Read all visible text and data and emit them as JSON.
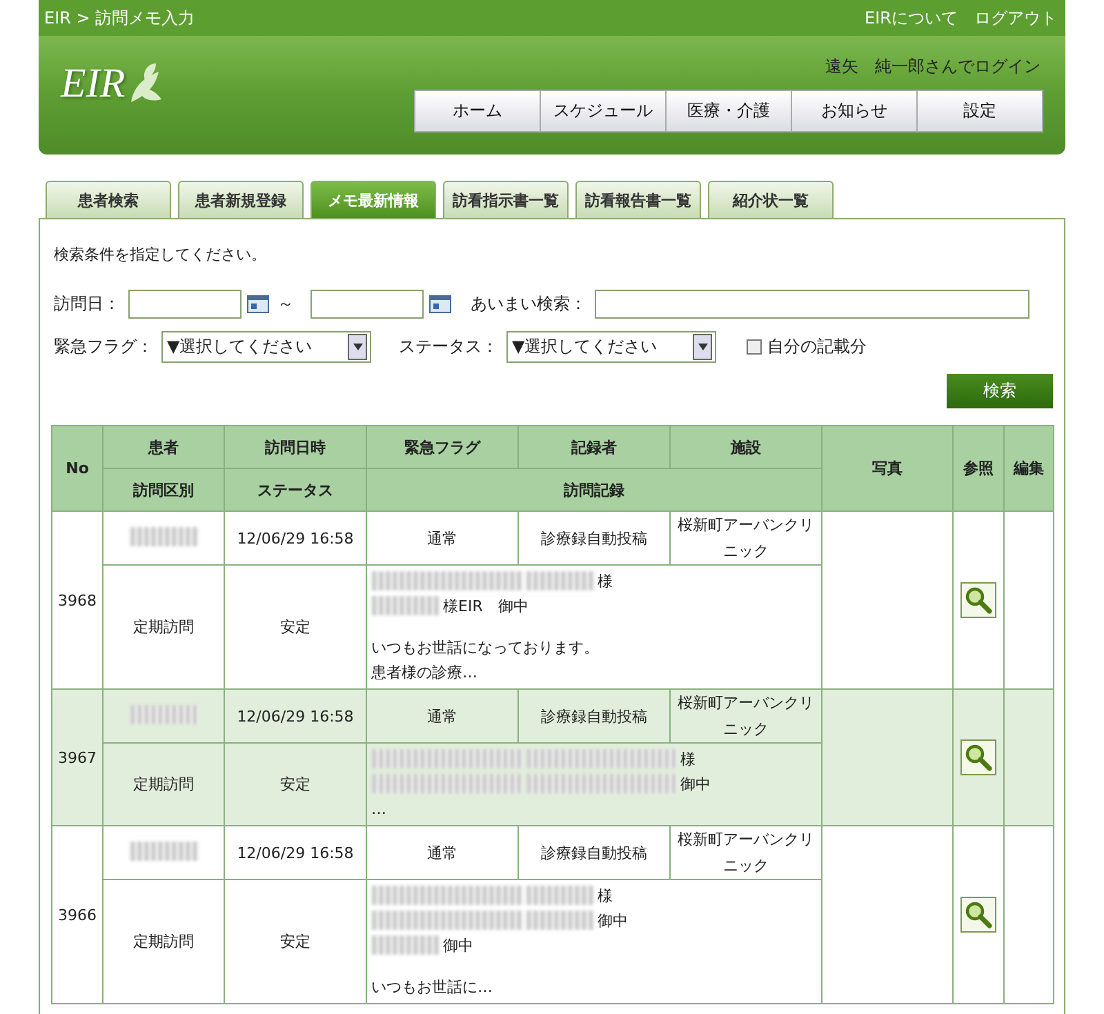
{
  "top_bar": {
    "breadcrumb": "EIR > 訪問メモ入力",
    "links": [
      "EIRについて",
      "ログアウト"
    ]
  },
  "header": {
    "logo": "EIR",
    "login_user": "遠矢　純一郎さんでログイン",
    "nav": [
      "ホーム",
      "スケジュール",
      "医療・介護",
      "お知らせ",
      "設定"
    ]
  },
  "tabs": [
    {
      "label": "患者検索",
      "selected": false
    },
    {
      "label": "患者新規登録",
      "selected": false
    },
    {
      "label": "メモ最新情報",
      "selected": true
    },
    {
      "label": "訪看指示書一覧",
      "selected": false
    },
    {
      "label": "訪看報告書一覧",
      "selected": false
    },
    {
      "label": "紹介状一覧",
      "selected": false
    }
  ],
  "search": {
    "instruction": "検索条件を指定してください。",
    "visit_date_label": "訪問日：",
    "range_sep": "～",
    "fuzzy_label": "あいまい検索：",
    "flag_label": "緊急フラグ：",
    "flag_value": "▼選択してください",
    "status_label": "ステータス：",
    "status_value": "▼選択してください",
    "own_only": {
      "label": "自分の記載分",
      "checked": false
    },
    "button": "検索"
  },
  "table": {
    "header_top": [
      "No",
      "患者",
      "訪問日時",
      "緊急フラグ",
      "記録者",
      "施設",
      "写真",
      "参照",
      "編集"
    ],
    "header_bottom": [
      "訪問区別",
      "ステータス",
      "訪問記録"
    ],
    "rows": [
      {
        "no": "3968",
        "shaded": false,
        "patient_blurred": true,
        "datetime": "12/06/29 16:58",
        "flag": "通常",
        "recorder": "診療録自動投稿",
        "facility": "桜新町アーバンクリニック",
        "visit_type": "定期訪問",
        "status": "安定",
        "record": [
          [
            [
              {
                "kind": "blur-long"
              },
              {
                "kind": "blur-short"
              },
              {
                "kind": "text",
                "text": "様"
              }
            ],
            [
              {
                "kind": "blur-short"
              },
              {
                "kind": "text",
                "text": "様EIR　御中"
              }
            ]
          ],
          [
            [
              {
                "kind": "text",
                "text": "いつもお世話になっております。"
              }
            ],
            [
              {
                "kind": "text",
                "text": "患者様の診療…"
              }
            ]
          ]
        ]
      },
      {
        "no": "3967",
        "shaded": true,
        "patient_blurred": true,
        "datetime": "12/06/29 16:58",
        "flag": "通常",
        "recorder": "診療録自動投稿",
        "facility": "桜新町アーバンクリニック",
        "visit_type": "定期訪問",
        "status": "安定",
        "record": [
          [
            [
              {
                "kind": "blur-long"
              },
              {
                "kind": "blur-long"
              },
              {
                "kind": "text",
                "text": "様"
              }
            ],
            [
              {
                "kind": "blur-long"
              },
              {
                "kind": "blur-long"
              },
              {
                "kind": "text",
                "text": "御中"
              }
            ],
            [
              {
                "kind": "text",
                "text": "…"
              }
            ]
          ]
        ]
      },
      {
        "no": "3966",
        "shaded": false,
        "patient_blurred": true,
        "datetime": "12/06/29 16:58",
        "flag": "通常",
        "recorder": "診療録自動投稿",
        "facility": "桜新町アーバンクリニック",
        "visit_type": "定期訪問",
        "status": "安定",
        "record": [
          [
            [
              {
                "kind": "blur-long"
              },
              {
                "kind": "blur-short"
              },
              {
                "kind": "text",
                "text": "様"
              }
            ],
            [
              {
                "kind": "blur-long"
              },
              {
                "kind": "blur-short"
              },
              {
                "kind": "text",
                "text": "御中"
              }
            ],
            [
              {
                "kind": "blur-short"
              },
              {
                "kind": "text",
                "text": "御中"
              }
            ]
          ],
          [
            [
              {
                "kind": "text",
                "text": "いつもお世話に…"
              }
            ]
          ]
        ]
      }
    ]
  }
}
